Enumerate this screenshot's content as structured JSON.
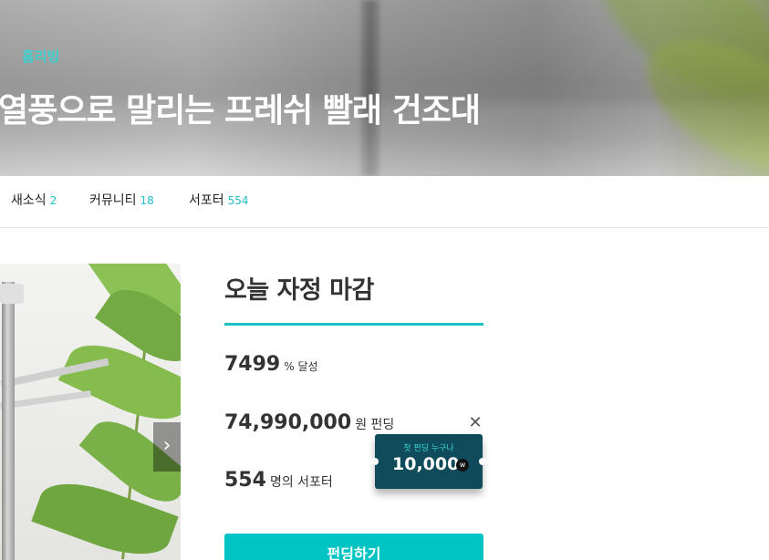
{
  "hero": {
    "category": "홈리빙",
    "title": "열풍으로 말리는 프레쉬 빨래 건조대"
  },
  "tabs": [
    {
      "label": "새소식",
      "count": "2"
    },
    {
      "label": "커뮤니티",
      "count": "18"
    },
    {
      "label": "서포터",
      "count": "554"
    }
  ],
  "funding": {
    "deadline": "오늘 자정 마감",
    "rate": {
      "value": "7499",
      "unit": "% 달성"
    },
    "amount": {
      "value": "74,990,000",
      "unit": "원 펀딩"
    },
    "supporters": {
      "value": "554",
      "unit": "명의 서포터"
    },
    "fund_button_label": "펀딩하기"
  },
  "coupon": {
    "label": "첫 펀딩 누구나",
    "amount": "10,000",
    "currency_mark": "w"
  },
  "icons": {
    "next_arrow": "chevron-right-icon",
    "close": "close-icon"
  },
  "colors": {
    "accent": "#1fbdc4",
    "button": "#00c4c4",
    "coupon_bg": "#0f4b5a"
  }
}
